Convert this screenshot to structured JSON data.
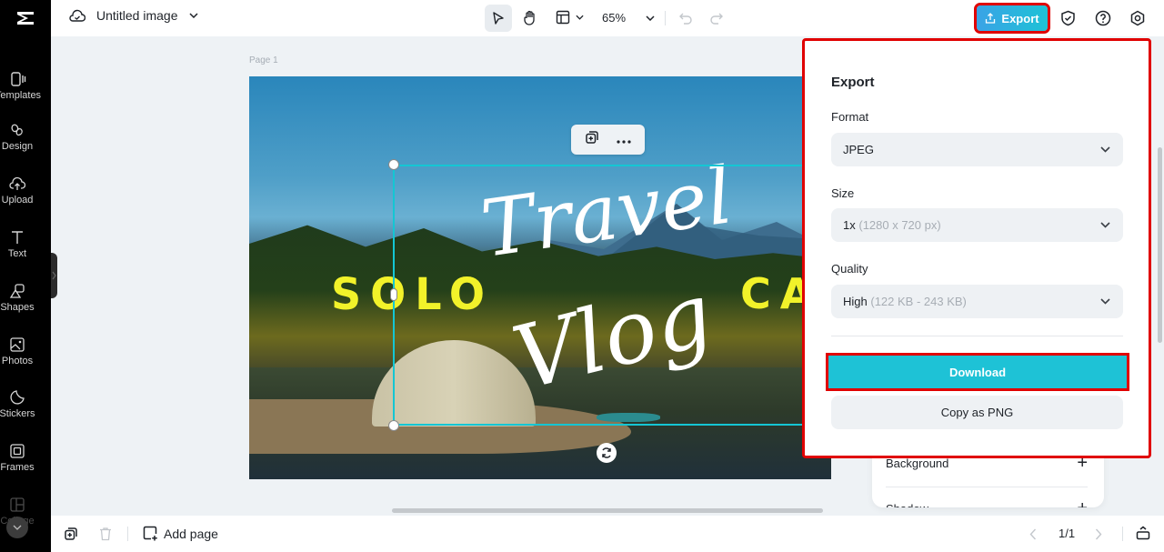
{
  "app": {
    "logo": "capcut-logo"
  },
  "sidebar": {
    "items": [
      {
        "label": "Templates",
        "icon": "templates-icon"
      },
      {
        "label": "Design",
        "icon": "design-icon"
      },
      {
        "label": "Upload",
        "icon": "upload-icon"
      },
      {
        "label": "Text",
        "icon": "text-icon"
      },
      {
        "label": "Shapes",
        "icon": "shapes-icon"
      },
      {
        "label": "Photos",
        "icon": "photos-icon"
      },
      {
        "label": "Stickers",
        "icon": "stickers-icon"
      },
      {
        "label": "Frames",
        "icon": "frames-icon"
      },
      {
        "label": "Collage",
        "icon": "collage-icon"
      }
    ]
  },
  "header": {
    "doc_title": "Untitled image",
    "zoom": "65%",
    "export_label": "Export"
  },
  "canvas": {
    "page_label": "Page 1",
    "texts": {
      "solo": "SOLO",
      "cal": "CAL",
      "travel": "Travel",
      "vlog": "Vlog"
    }
  },
  "export_panel": {
    "title": "Export",
    "format_label": "Format",
    "format_value": "JPEG",
    "size_label": "Size",
    "size_value": "1x",
    "size_hint": "(1280 x 720 px)",
    "quality_label": "Quality",
    "quality_value": "High",
    "quality_hint": "(122 KB - 243 KB)",
    "download_label": "Download",
    "copy_label": "Copy as PNG"
  },
  "props_panel": {
    "rows": [
      {
        "label": "Background"
      },
      {
        "label": "Shadow"
      }
    ]
  },
  "footer": {
    "add_page_label": "Add page",
    "page_count": "1/1"
  },
  "colors": {
    "accent": "#1ec2d6",
    "highlight": "#e00000",
    "title_yellow": "#f2f22a"
  }
}
